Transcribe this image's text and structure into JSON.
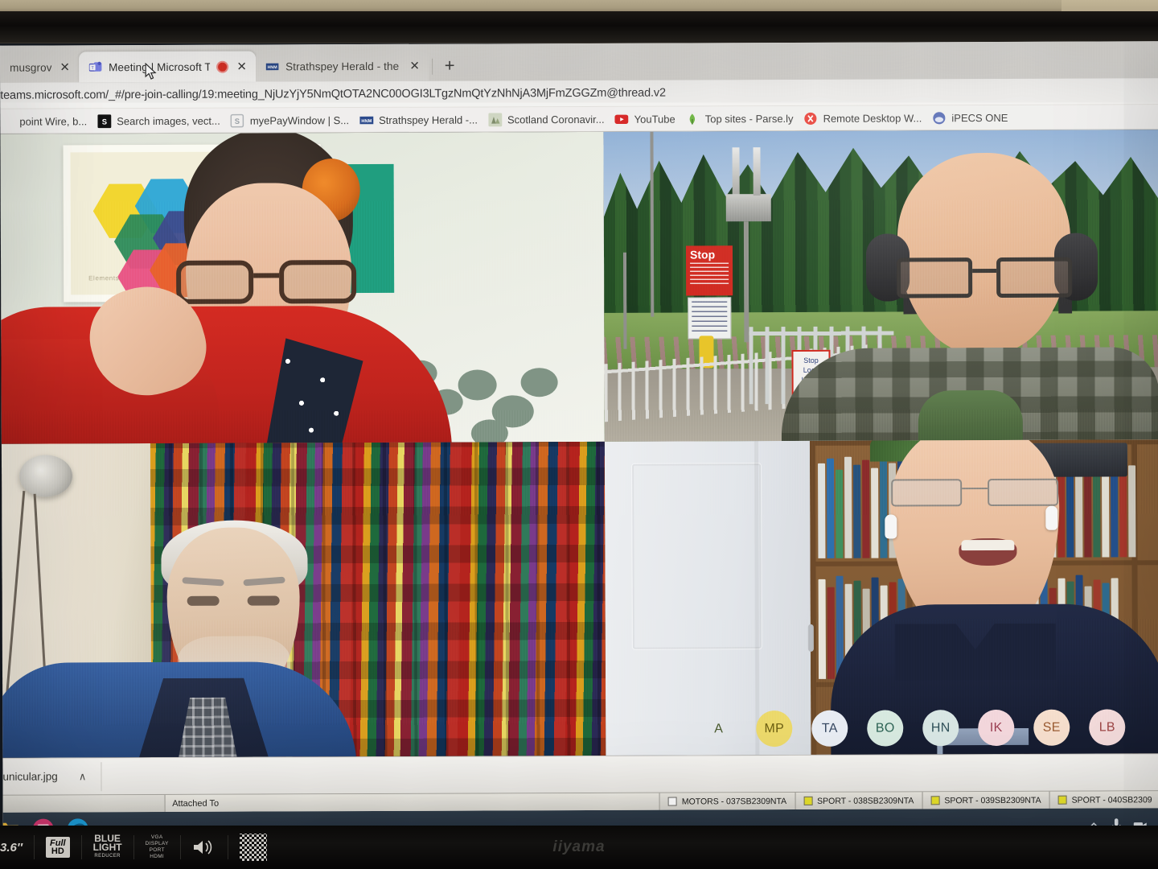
{
  "browser": {
    "tabs": [
      {
        "title": "musgrove@ho",
        "favicon": "none",
        "active": false,
        "has_recording_dot": false,
        "close_label": "✕"
      },
      {
        "title": "Meeting | Microsoft Teams",
        "favicon": "teams-icon",
        "active": true,
        "has_recording_dot": true,
        "close_label": "✕"
      },
      {
        "title": "Strathspey Herald - the latest Ne",
        "favicon": "hnm-icon",
        "active": false,
        "has_recording_dot": false,
        "close_label": "✕"
      }
    ],
    "new_tab_label": "+",
    "url": "teams.microsoft.com/_#/pre-join-calling/19:meeting_NjUzYjY5NmQtOTA2NC00OGI3LTgzNmQtYzNhNjA3MjFmZGGZm@thread.v2",
    "bookmarks": [
      {
        "label": "point Wire, b...",
        "icon": "generic-icon",
        "color": "#8a8a8a"
      },
      {
        "label": "Search images, vect...",
        "icon": "shutterstock-icon",
        "color": "#111111"
      },
      {
        "label": "myePayWindow | S...",
        "icon": "s-icon",
        "color": "#9aa0a6"
      },
      {
        "label": "Strathspey Herald -...",
        "icon": "hnm-icon",
        "color": "#2b4a8b"
      },
      {
        "label": "Scotland Coronavir...",
        "icon": "scotland-icon",
        "color": "#7e8c6a"
      },
      {
        "label": "YouTube",
        "icon": "youtube-icon",
        "color": "#d62322"
      },
      {
        "label": "Top sites - Parse.ly",
        "icon": "parsely-icon",
        "color": "#6cb33f"
      },
      {
        "label": "Remote Desktop W...",
        "icon": "remote-desktop-icon",
        "color": "#e8453c"
      },
      {
        "label": "iPECS ONE",
        "icon": "ipecs-icon",
        "color": "#5b6fb5"
      }
    ]
  },
  "meeting": {
    "participant_tiles": [
      {
        "id": "tile-1",
        "position": "top-left",
        "description": "Woman with glasses in red jumper, hexagon art poster on pale green wall",
        "wall_color": "#e5e9df",
        "jumper_color": "#c8231d",
        "poster_hexes": [
          "#f2d427",
          "#2aa5d6",
          "#2c8a5a",
          "#3d4a8c",
          "#e84f82",
          "#e8622a"
        ]
      },
      {
        "id": "tile-2",
        "position": "top-right",
        "description": "Bald man with glasses and over-ear headphones, plaid shirt, level crossing background",
        "sign_stop_text": "Stop",
        "sign_look_listen_text": "Stop\nLook\nListen",
        "sign_color": "#cf2319",
        "shirt_color": "#7e8174"
      },
      {
        "id": "tile-3",
        "position": "bottom-left",
        "description": "Elderly man with white hair and beard in blue jacket, colourful woven textile behind",
        "jacket_color": "#27508f"
      },
      {
        "id": "tile-4",
        "position": "bottom-right",
        "description": "Speaking man with glasses and AirPods, navy polo shirt, bookshelves and white door",
        "polo_color": "#1b2239"
      }
    ],
    "avatars": [
      {
        "initials": "A",
        "bg": "#f1f4e0",
        "fg": "#4a5a2e",
        "ghost": true
      },
      {
        "initials": "MP",
        "bg": "#ecd96a",
        "fg": "#6a5d12",
        "ghost": false
      },
      {
        "initials": "TA",
        "bg": "#e8ecf3",
        "fg": "#394a63",
        "ghost": false
      },
      {
        "initials": "BO",
        "bg": "#d7e9e0",
        "fg": "#2d6354",
        "ghost": false
      },
      {
        "initials": "HN",
        "bg": "#d8e6e4",
        "fg": "#2f4f58",
        "ghost": false
      },
      {
        "initials": "IK",
        "bg": "#f3d7dc",
        "fg": "#9b3f52",
        "ghost": false
      },
      {
        "initials": "SE",
        "bg": "#f6dfcd",
        "fg": "#9a5b32",
        "ghost": false
      },
      {
        "initials": "LB",
        "bg": "#f5dcdc",
        "fg": "#9e4646",
        "ghost": false
      }
    ]
  },
  "downloads": {
    "file_name": "unicular.jpg",
    "caret_label": "∧"
  },
  "windows": {
    "attached_to_label": "Attached To",
    "taskbar_items": [
      {
        "label": "MOTORS - 037SB2309NTA",
        "swatch": "#ffffff"
      },
      {
        "label": "SPORT - 038SB2309NTA",
        "swatch": "#e8e32a"
      },
      {
        "label": "SPORT - 039SB2309NTA",
        "swatch": "#e8e32a"
      },
      {
        "label": "SPORT - 040SB2309",
        "swatch": "#e8e32a"
      }
    ],
    "taskbar_icons": [
      {
        "name": "explorer-icon",
        "color": "#e9b63c"
      },
      {
        "name": "indesign-icon",
        "color": "#d4366f"
      },
      {
        "name": "edge-icon",
        "color": "#1a9ad7"
      }
    ],
    "tray_icons": [
      "chevron-up-icon",
      "microphone-icon",
      "camera-icon"
    ]
  },
  "monitor": {
    "brand": "iiyama",
    "bezel_labels": {
      "size": "3.6″",
      "full": "Full",
      "hd": "HD",
      "blue": "BLUE",
      "light": "LIGHT",
      "reducer": "REDUCER",
      "ports": "VGA\nDISPLAY\nPORT\nHDMI"
    }
  }
}
